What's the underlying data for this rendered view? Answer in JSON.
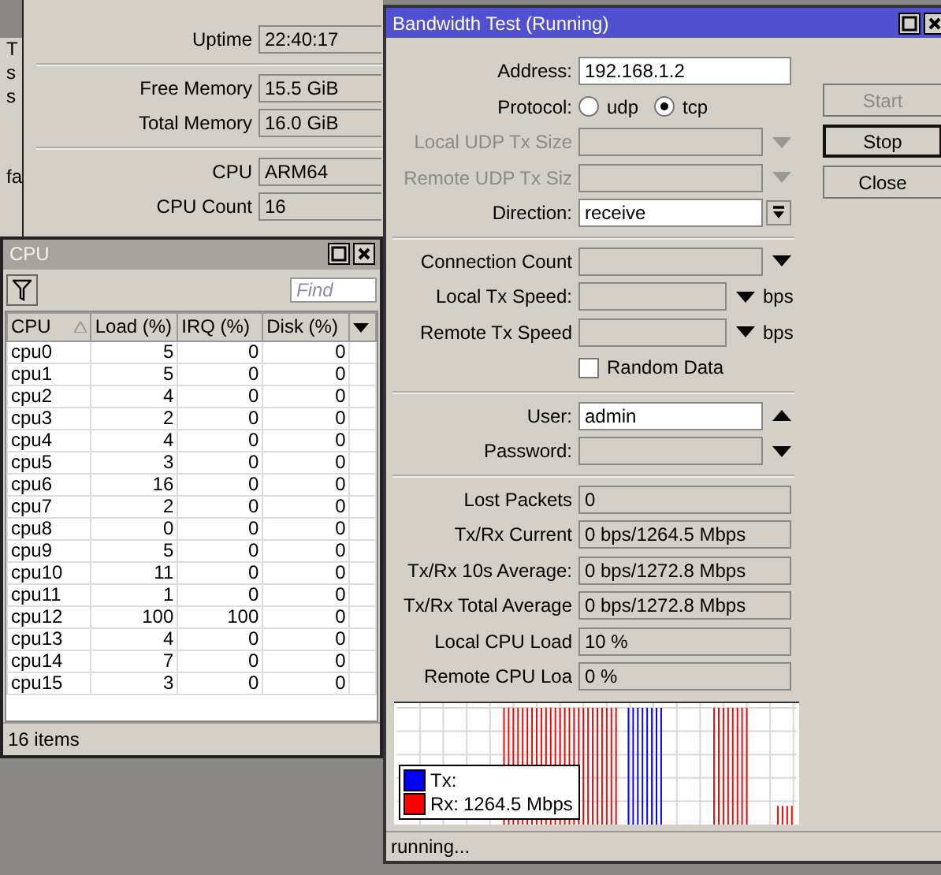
{
  "back_window": {
    "fragments": [
      "T",
      "s",
      "s",
      "fa"
    ]
  },
  "resources_window": {
    "rows": [
      {
        "kind": "readout",
        "label": "Uptime",
        "value": "22:40:17"
      },
      {
        "kind": "separator"
      },
      {
        "kind": "readout",
        "label": "Free Memory",
        "value": "15.5 GiB"
      },
      {
        "kind": "readout",
        "label": "Total Memory",
        "value": "16.0 GiB"
      },
      {
        "kind": "separator"
      },
      {
        "kind": "readout",
        "label": "CPU",
        "value": "ARM64"
      },
      {
        "kind": "readout",
        "label": "CPU Count",
        "value": "16"
      }
    ]
  },
  "cpu_window": {
    "title": "CPU",
    "active": false,
    "search": {
      "placeholder": "Find"
    },
    "columns": [
      {
        "label": "CPU",
        "sorted": true
      },
      {
        "label": "Load (%)",
        "sorted": false
      },
      {
        "label": "IRQ (%)",
        "sorted": false
      },
      {
        "label": "Disk (%)",
        "sorted": false
      }
    ],
    "rows": [
      [
        "cpu0",
        "5",
        "0",
        "0"
      ],
      [
        "cpu1",
        "5",
        "0",
        "0"
      ],
      [
        "cpu2",
        "4",
        "0",
        "0"
      ],
      [
        "cpu3",
        "2",
        "0",
        "0"
      ],
      [
        "cpu4",
        "4",
        "0",
        "0"
      ],
      [
        "cpu5",
        "3",
        "0",
        "0"
      ],
      [
        "cpu6",
        "16",
        "0",
        "0"
      ],
      [
        "cpu7",
        "2",
        "0",
        "0"
      ],
      [
        "cpu8",
        "0",
        "0",
        "0"
      ],
      [
        "cpu9",
        "5",
        "0",
        "0"
      ],
      [
        "cpu10",
        "11",
        "0",
        "0"
      ],
      [
        "cpu11",
        "1",
        "0",
        "0"
      ],
      [
        "cpu12",
        "100",
        "100",
        "0"
      ],
      [
        "cpu13",
        "4",
        "0",
        "0"
      ],
      [
        "cpu14",
        "7",
        "0",
        "0"
      ],
      [
        "cpu15",
        "3",
        "0",
        "0"
      ]
    ],
    "status": "16 items"
  },
  "bandwidth_window": {
    "title": "Bandwidth Test (Running)",
    "active": true,
    "buttons": [
      {
        "label": "Start",
        "disabled": true,
        "focused": false
      },
      {
        "label": "Stop",
        "disabled": false,
        "focused": true
      },
      {
        "label": "Close",
        "disabled": false,
        "focused": false
      }
    ],
    "rows": [
      {
        "kind": "field",
        "label": "Address:",
        "value": "192.168.1.2"
      },
      {
        "kind": "radio",
        "label": "Protocol:",
        "options": [
          {
            "label": "udp",
            "selected": false
          },
          {
            "label": "tcp",
            "selected": true
          }
        ]
      },
      {
        "kind": "combo",
        "label": "Local UDP Tx Size",
        "disabled": true,
        "arrow_up": false
      },
      {
        "kind": "combo",
        "label": "Remote UDP Tx Siz",
        "disabled": true,
        "arrow_up": false
      },
      {
        "kind": "select",
        "label": "Direction:",
        "value": "receive"
      },
      {
        "kind": "separator"
      },
      {
        "kind": "combo",
        "label": "Connection Count",
        "disabled": false,
        "arrow_up": false
      },
      {
        "kind": "speed",
        "label": "Local Tx Speed:",
        "unit": "bps"
      },
      {
        "kind": "speed",
        "label": "Remote Tx Speed",
        "unit": "bps"
      },
      {
        "kind": "checkbox",
        "label": "Random Data",
        "checked": false
      },
      {
        "kind": "separator"
      },
      {
        "kind": "combo",
        "label": "User:",
        "value": "admin",
        "disabled": false,
        "arrow_up": true
      },
      {
        "kind": "combo",
        "label": "Password:",
        "disabled": false,
        "arrow_up": false
      },
      {
        "kind": "separator"
      },
      {
        "kind": "readout",
        "label": "Lost Packets",
        "value": "0"
      },
      {
        "kind": "readout",
        "label": "Tx/Rx Current",
        "value": "0 bps/1264.5 Mbps"
      },
      {
        "kind": "readout",
        "label": "Tx/Rx 10s Average:",
        "value": "0 bps/1272.8 Mbps"
      },
      {
        "kind": "readout",
        "label": "Tx/Rx Total Average",
        "value": "0 bps/1272.8 Mbps"
      },
      {
        "kind": "readout",
        "label": "Local CPU Load",
        "value": "10 %"
      },
      {
        "kind": "readout",
        "label": "Remote CPU Loa",
        "value": "0 %"
      }
    ],
    "graph": {
      "legend": [
        {
          "label": "Tx:",
          "color": "#0000ff"
        },
        {
          "label": "Rx:",
          "value": "1264.5 Mbps",
          "color": "#ff0000"
        }
      ]
    },
    "status": "running..."
  }
}
